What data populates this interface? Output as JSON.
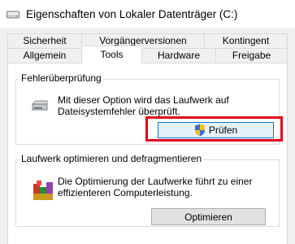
{
  "window": {
    "title": "Eigenschaften von Lokaler Datenträger (C:)",
    "title_icon": "drive-icon"
  },
  "tabs": {
    "row1": [
      {
        "label": "Sicherheit"
      },
      {
        "label": "Vorgängerversionen"
      },
      {
        "label": "Kontingent"
      }
    ],
    "row2": [
      {
        "label": "Allgemein"
      },
      {
        "label": "Tools",
        "active": true
      },
      {
        "label": "Hardware"
      },
      {
        "label": "Freigabe"
      }
    ]
  },
  "error_check": {
    "heading": "Fehlerüberprüfung",
    "description_line1": "Mit dieser Option wird das Laufwerk auf",
    "description_line2": "Dateisystemfehler überprüft.",
    "button_label": "Prüfen",
    "icon": "hard-drive-icon",
    "button_icon": "uac-shield-icon"
  },
  "optimize": {
    "heading": "Laufwerk optimieren und defragmentieren",
    "description_line1": "Die Optimierung der Laufwerke führt zu einer",
    "description_line2": "effizienteren Computerleistung.",
    "button_label": "Optimieren",
    "icon": "defrag-icon"
  },
  "colors": {
    "highlight": "#e0001b",
    "focus": "#0078d7"
  }
}
